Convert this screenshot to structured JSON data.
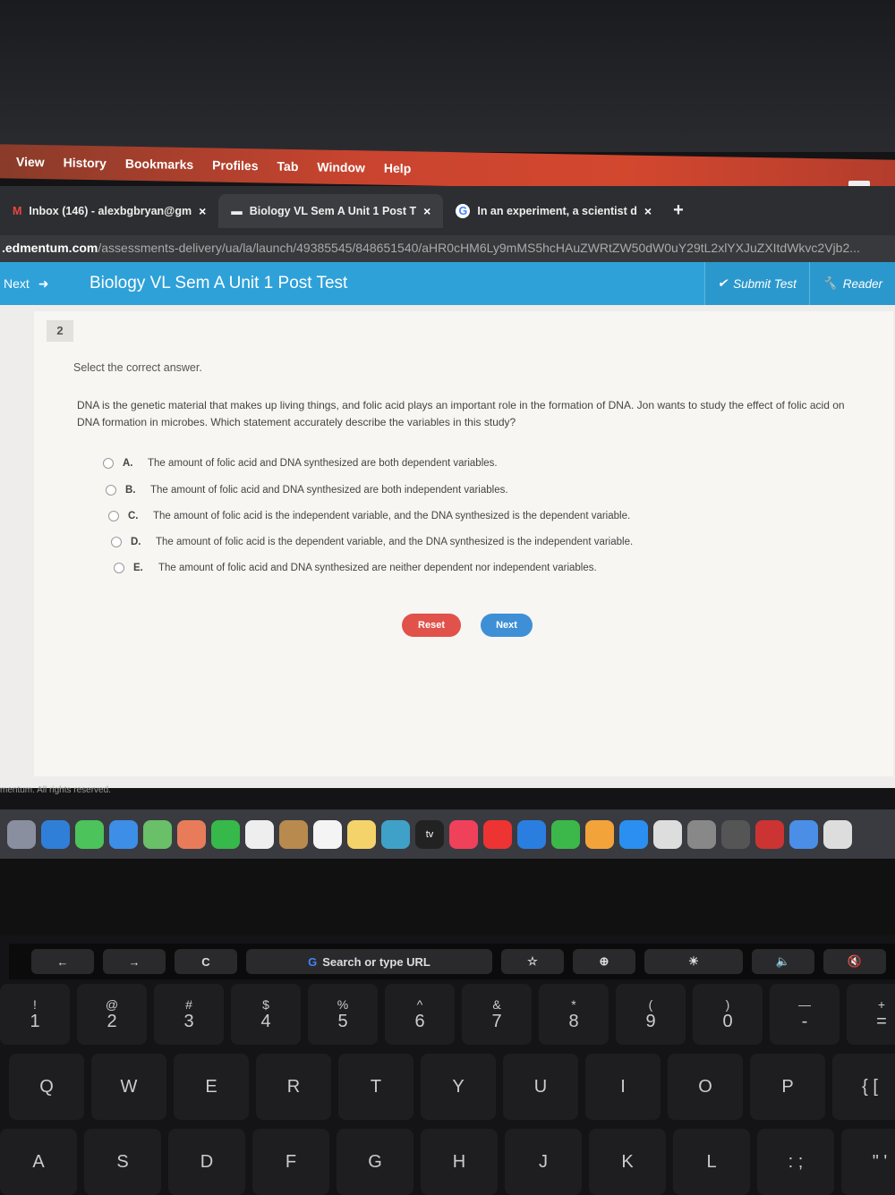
{
  "menu": [
    "View",
    "History",
    "Bookmarks",
    "Profiles",
    "Tab",
    "Window",
    "Help"
  ],
  "tabs": [
    {
      "label": "Inbox (146) - alexbgbryan@gm",
      "close": "×"
    },
    {
      "label": "Biology VL Sem A Unit 1 Post T",
      "close": "×"
    },
    {
      "label": "In an experiment, a scientist d",
      "close": "×"
    }
  ],
  "new_tab": "+",
  "url": {
    "domain": ".edmentum.com",
    "path": "/assessments-delivery/ua/la/launch/49385545/848651540/aHR0cHM6Ly9mMS5hcHAuZWRtZW50dW0uY29tL2xlYXJuZXItdWkvc2Vjb2..."
  },
  "header": {
    "next": "Next",
    "title": "Biology VL Sem A Unit 1 Post Test",
    "submit": "Submit Test",
    "reader": "Reader"
  },
  "question": {
    "number": "2",
    "instruction": "Select the correct answer.",
    "stem": "DNA is the genetic material that makes up living things, and folic acid plays an important role in the formation of DNA. Jon wants to study the effect of folic acid on DNA formation in microbes. Which statement accurately describe the variables in this study?",
    "options": [
      {
        "letter": "A.",
        "text": "The amount of folic acid and DNA synthesized are both dependent variables."
      },
      {
        "letter": "B.",
        "text": "The amount of folic acid and DNA synthesized are both independent variables."
      },
      {
        "letter": "C.",
        "text": "The amount of folic acid is the independent variable, and the DNA synthesized is the dependent variable."
      },
      {
        "letter": "D.",
        "text": "The amount of folic acid is the dependent variable, and the DNA synthesized is the independent variable."
      },
      {
        "letter": "E.",
        "text": "The amount of folic acid and DNA synthesized are neither dependent nor independent variables."
      }
    ],
    "reset": "Reset",
    "next": "Next"
  },
  "footer": "mentum. All rights reserved.",
  "dock_tv": "tv",
  "touchbar": {
    "back": "←",
    "forward": "→",
    "reload": "C",
    "search": "Search or type URL"
  },
  "keys": {
    "numbers": [
      [
        "!",
        "1"
      ],
      [
        "@",
        "2"
      ],
      [
        "#",
        "3"
      ],
      [
        "$",
        "4"
      ],
      [
        "%",
        "5"
      ],
      [
        "^",
        "6"
      ],
      [
        "&",
        "7"
      ],
      [
        "*",
        "8"
      ],
      [
        "(",
        "9"
      ],
      [
        ")",
        "0"
      ],
      [
        "—",
        "-"
      ],
      [
        "+",
        "="
      ]
    ],
    "qrow": [
      "Q",
      "W",
      "E",
      "R",
      "T",
      "Y",
      "U",
      "I",
      "O",
      "P",
      "{ ["
    ],
    "arow": [
      "A",
      "S",
      "D",
      "F",
      "G",
      "H",
      "J",
      "K",
      "L",
      ": ;",
      "\" '"
    ]
  },
  "colors": {
    "menubar": "#c9442f",
    "header": "#2ea1d9",
    "reset": "#e0524a",
    "next": "#3f8fd6"
  }
}
